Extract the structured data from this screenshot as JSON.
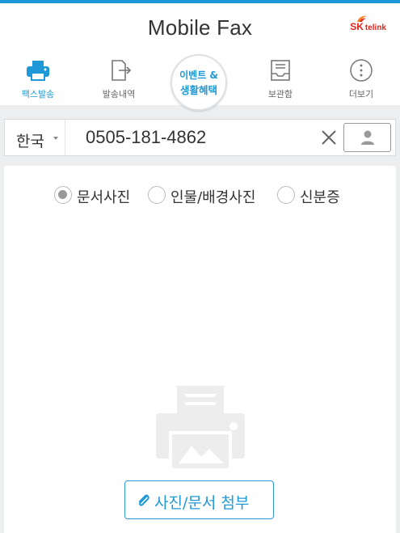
{
  "app": {
    "title": "Mobile Fax",
    "brand": {
      "sk": "SK",
      "telink": "telink"
    },
    "accent_color": "#1e98d6",
    "brand_color": "#e2231a"
  },
  "nav": {
    "items": [
      {
        "label": "팩스발송",
        "icon": "fax-printer-icon",
        "active": true
      },
      {
        "label": "발송내역",
        "icon": "send-history-icon",
        "active": false
      },
      {
        "label": "보관함",
        "icon": "storage-box-icon",
        "active": false
      },
      {
        "label": "더보기",
        "icon": "more-dots-icon",
        "active": false
      }
    ],
    "event": {
      "line1": "이벤트 &",
      "line2": "생활혜택"
    }
  },
  "recipient": {
    "country": "한국",
    "phone_number": "0505-181-4862",
    "clear_icon": "close-icon",
    "contact_icon": "person-icon"
  },
  "attach_type": {
    "options": [
      "문서사진",
      "인물/배경사진",
      "신분증"
    ],
    "selected": "문서사진"
  },
  "attach_button": {
    "label": "사진/문서 첨부",
    "icon": "paperclip-icon"
  },
  "illustration": "fax-machine-icon"
}
